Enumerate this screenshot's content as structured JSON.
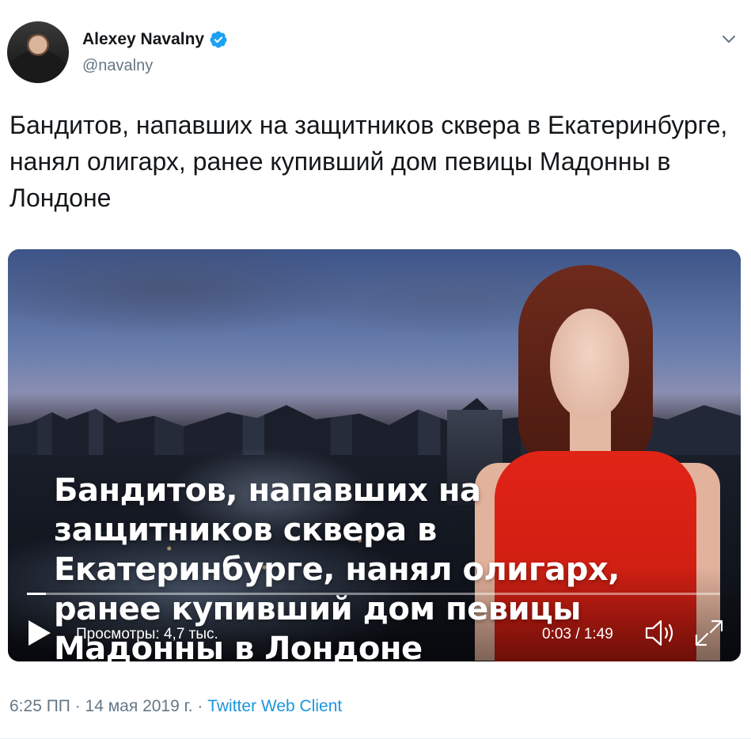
{
  "author": {
    "name": "Alexey Navalny",
    "handle": "@navalny",
    "verified": true
  },
  "tweet": {
    "text": "Бандитов, напавших на защитников сквера в Екатеринбурге, нанял олигарх, ранее купивший дом певицы Мадонны в Лондоне"
  },
  "video": {
    "caption": "Бандитов, напавших на защитников сквера в Екатеринбурге, нанял олигарх, ранее купивший дом певицы Мадонны в Лондоне",
    "views": "Просмотры: 4,7 тыс.",
    "time": "0:03 / 1:49",
    "progress": 0.027
  },
  "meta": {
    "time_date": "6:25 ПП · 14 мая 2019 г. · ",
    "source": "Twitter Web Client"
  },
  "icons": {
    "verified": "verified-badge-icon",
    "caret": "chevron-down-icon",
    "play": "play-icon",
    "volume": "volume-icon",
    "fullscreen": "fullscreen-icon"
  },
  "colors": {
    "link": "#1b95e0",
    "verified": "#1da1f2",
    "muted": "#657786"
  }
}
